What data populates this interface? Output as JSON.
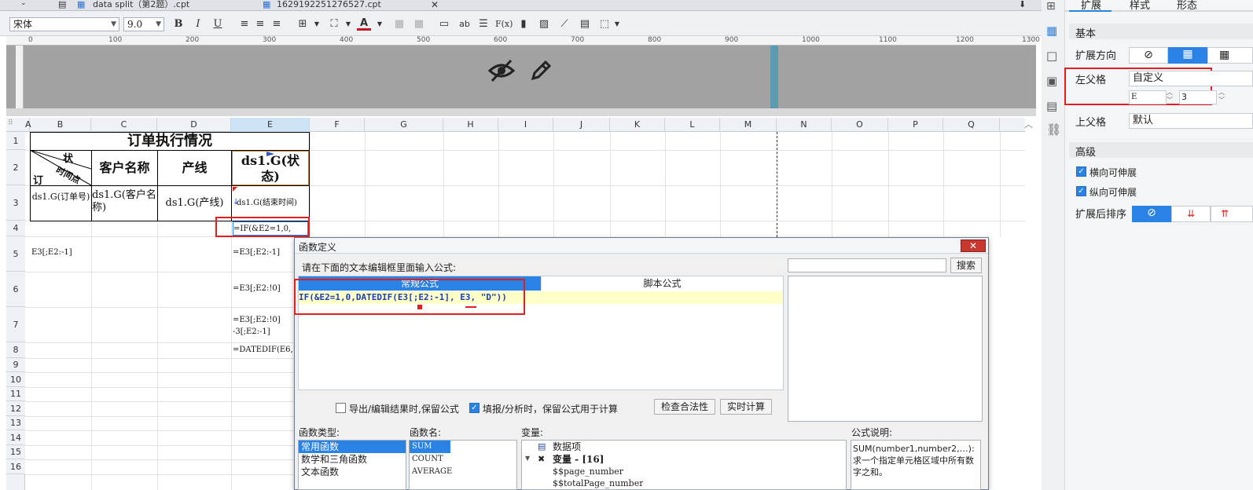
{
  "tabs": [
    {
      "label": "data split（第2题）.cpt"
    },
    {
      "label": "1629192251276527.cpt"
    }
  ],
  "toolbar": {
    "font_name": "宋体",
    "font_size": "9.0",
    "bold": "B",
    "italic": "I",
    "underline": "U",
    "text_tool": "ab",
    "formula_tool": "F(x)"
  },
  "ruler": {
    "ticks": [
      "0",
      "100",
      "200",
      "300",
      "400",
      "500",
      "600",
      "700",
      "800",
      "900",
      "1000",
      "1100",
      "1200",
      "1300"
    ]
  },
  "columns": [
    "A",
    "B",
    "C",
    "D",
    "E",
    "F",
    "G",
    "H",
    "I",
    "J",
    "K",
    "L",
    "M",
    "N",
    "O",
    "P",
    "Q"
  ],
  "rows": [
    "1",
    "2",
    "3",
    "4",
    "5",
    "6",
    "7",
    "8",
    "9",
    "10",
    "11",
    "12",
    "13",
    "14",
    "15",
    "16"
  ],
  "cells": {
    "title": "订单执行情况",
    "diag_top": "状",
    "diag_mid": "时间点",
    "diag_bottom": "订",
    "c2": "客户名称",
    "d2": "产线",
    "e2": "ds1.G(状态)",
    "b3": "ds1.G(订单号)",
    "c3": "ds1.G(客户名称)",
    "d3": "ds1.G(产线)",
    "e3": "ds1.G(结束时间)",
    "e4": "=IF(&E2=1,0,",
    "b5": "E3[;E2:-1]",
    "e5": "=E3[;E2:-1]",
    "e6": "=E3[;E2:!0]",
    "e7": "=E3[;E2:!0] -3[;E2:-1]",
    "e8": "=DATEDIF(E6,"
  },
  "dialog": {
    "title": "函数定义",
    "close": "✕",
    "prompt": "请在下面的文本编辑框里面输入公式:",
    "tab_normal": "常规公式",
    "tab_script": "脚本公式",
    "formula": "IF(&E2=1,0,DATEDIF(E3[;E2:-1], E3, \"D\"))",
    "search_button": "搜索",
    "search_value": "",
    "chk_export": "导出/编辑结果时,保留公式",
    "chk_fill": "填报/分析时，保留公式用于计算",
    "check_button": "检查合法性",
    "realtime_button": "实时计算",
    "fn_type_label": "函数类型:",
    "fn_name_label": "函数名:",
    "var_label": "变量:",
    "desc_label": "公式说明:",
    "fn_types": [
      "常用函数",
      "数学和三角函数",
      "文本函数"
    ],
    "fn_names": [
      "SUM",
      "COUNT",
      "AVERAGE"
    ],
    "vars": [
      "数据项",
      "变量 - [16]",
      "$$page_number",
      "$$totalPage_number"
    ],
    "desc": "SUM(number1,number2,…):求一个指定单元格区域中所有数字之和。"
  },
  "panel": {
    "tabs": [
      "扩展",
      "样式",
      "形态"
    ],
    "basic": "基本",
    "expand_dir": "扩展方向",
    "left_parent": "左父格",
    "left_parent_value": "自定义",
    "left_parent_col": "E",
    "left_parent_row": "3",
    "upper_parent": "上父格",
    "upper_parent_value": "默认",
    "advanced": "高级",
    "h_expand": "横向可伸展",
    "v_expand": "纵向可伸展",
    "sort_after": "扩展后排序"
  },
  "colors": {
    "accent": "#2a82e4",
    "highlight_red": "#e02020",
    "formula_bg": "#ffffc8"
  }
}
